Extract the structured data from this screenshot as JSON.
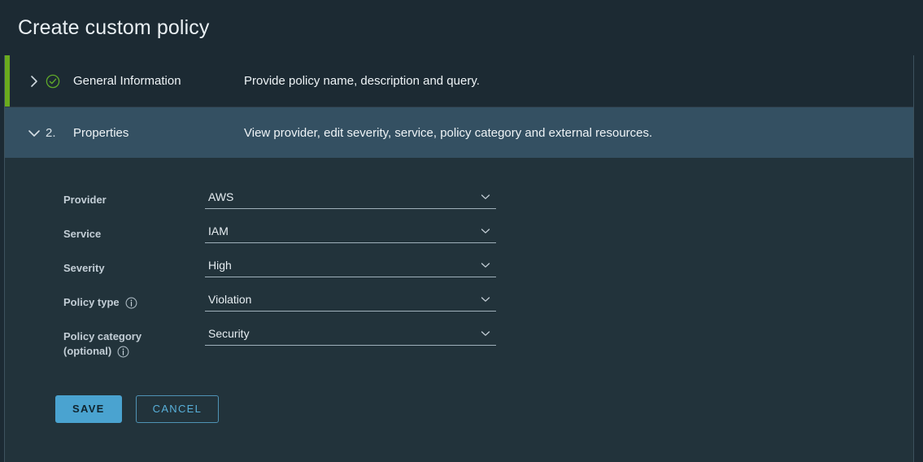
{
  "header": {
    "title": "Create custom policy"
  },
  "sections": [
    {
      "marker": "",
      "marker_icon": "check-circle-icon",
      "chevron": "chevron-right-icon",
      "title": "General Information",
      "description": "Provide policy name, description and query.",
      "state": "collapsed",
      "accent_color": "#6aab1e"
    },
    {
      "marker": "2.",
      "marker_icon": "",
      "chevron": "chevron-down-icon",
      "title": "Properties",
      "description": "View provider, edit severity, service, policy category and external resources.",
      "state": "expanded",
      "accent_color": ""
    }
  ],
  "form": {
    "fields": [
      {
        "label": "Provider",
        "label_second_line": "",
        "info": false,
        "info_second_line": false,
        "value": "AWS"
      },
      {
        "label": "Service",
        "label_second_line": "",
        "info": false,
        "info_second_line": false,
        "value": "IAM"
      },
      {
        "label": "Severity",
        "label_second_line": "",
        "info": false,
        "info_second_line": false,
        "value": "High"
      },
      {
        "label": "Policy type",
        "label_second_line": "",
        "info": true,
        "info_second_line": false,
        "value": "Violation"
      },
      {
        "label": "Policy category",
        "label_second_line": "(optional)",
        "info": false,
        "info_second_line": true,
        "value": "Security"
      }
    ]
  },
  "actions": {
    "save_label": "SAVE",
    "cancel_label": "CANCEL"
  },
  "colors": {
    "accent_green": "#6aab1e",
    "primary_button": "#4aa3d0",
    "secondary_text": "#58b0da",
    "active_row": "#345062",
    "panel_bg": "#22333b",
    "header_bg": "#1c2a33"
  }
}
